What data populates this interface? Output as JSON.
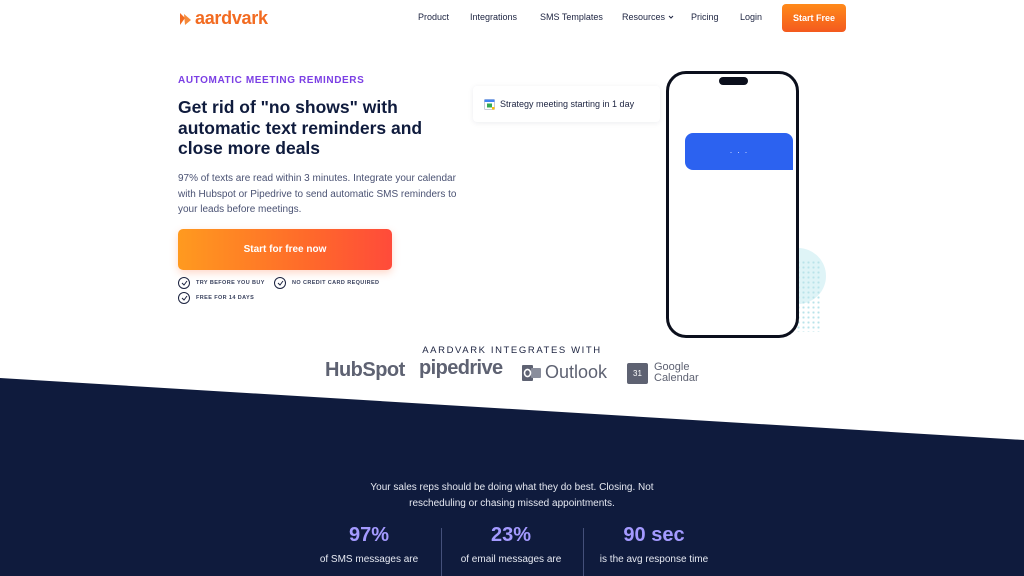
{
  "brand": {
    "name": "aardvark",
    "accent": "#f26b21",
    "navy": "#0f1b3d",
    "purple": "#7b3fe4"
  },
  "nav": {
    "links": [
      "Product",
      "Integrations",
      "SMS Templates",
      "Resources",
      "Pricing",
      "Login"
    ],
    "resources_icon": "chevron-down-icon",
    "cta": "Start Free"
  },
  "hero": {
    "eyebrow": "AUTOMATIC MEETING REMINDERS",
    "headline": "Get rid of \"no shows\" with automatic text reminders and close more deals",
    "sub": "97% of texts are read within 3 minutes. Integrate your calendar with Hubspot or Pipedrive to send automatic SMS reminders to your leads before meetings.",
    "cta": "Start for free now",
    "checks": [
      "TRY BEFORE YOU BUY",
      "NO CREDIT CARD REQUIRED",
      "FREE FOR 14 DAYS"
    ]
  },
  "notification": {
    "text": "Strategy meeting starting in 1 day",
    "icon": "google-calendar-icon"
  },
  "phone": {
    "bubble_text": "· · ·"
  },
  "integrations": {
    "title": "AARDVARK INTEGRATES WITH",
    "logos": [
      "HubSpot",
      "pipedrive",
      "Outlook",
      "Google Calendar"
    ],
    "hubspot": "HubSpot",
    "pipedrive": "pipedrive",
    "outlook": "Outlook",
    "gcal_line1": "Google",
    "gcal_line2": "Calendar",
    "gcal_day": "31"
  },
  "dark": {
    "line1": "Your sales reps should be doing what they do best. Closing. Not",
    "line2": "rescheduling or chasing missed appointments.",
    "stats": [
      {
        "value": "97%",
        "label": "of SMS messages are"
      },
      {
        "value": "23%",
        "label": "of email messages are"
      },
      {
        "value": "90 sec",
        "label": "is the avg response time"
      }
    ]
  }
}
